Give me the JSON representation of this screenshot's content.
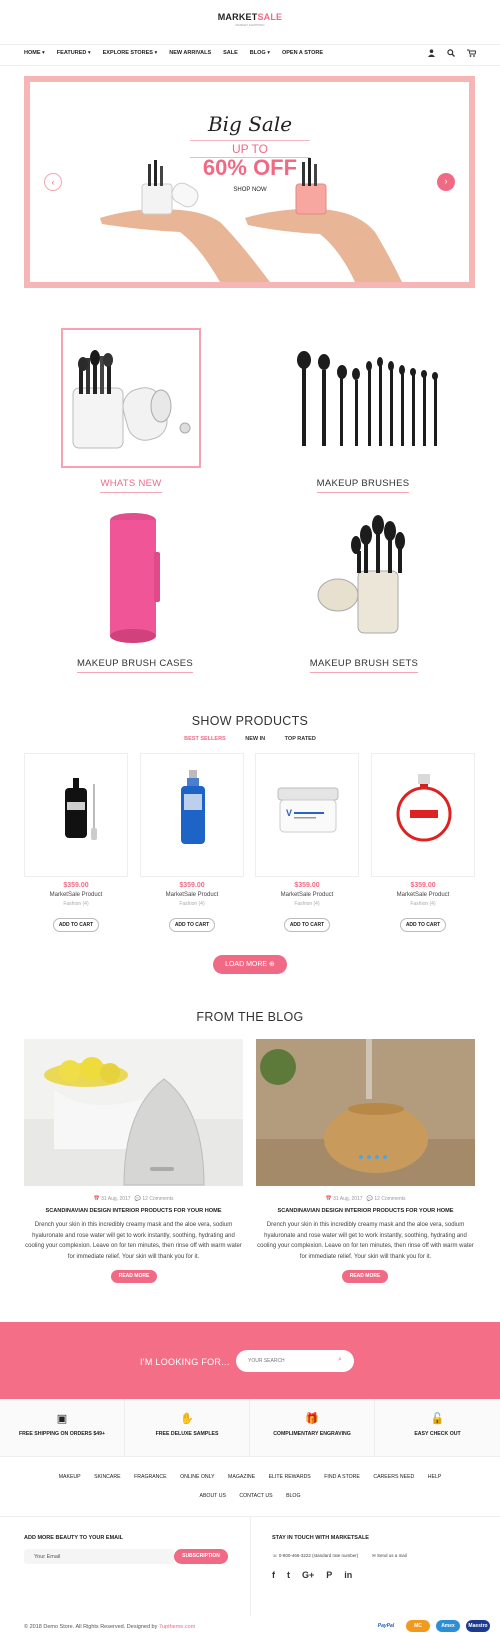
{
  "header": {
    "logo_main": "MARKET",
    "logo_accent": "SALE",
    "logo_tagline": "MARKET SHOPPING",
    "nav": [
      {
        "label": "HOME ▾"
      },
      {
        "label": "FEATURED ▾"
      },
      {
        "label": "EXPLORE STORES ▾"
      },
      {
        "label": "NEW ARRIVALS"
      },
      {
        "label": "SALE"
      },
      {
        "label": "BLOG ▾"
      },
      {
        "label": "OPEN A STORE"
      }
    ]
  },
  "hero": {
    "headline": "Big Sale",
    "upto": "UP TO",
    "discount": "60% OFF",
    "cta": "SHOP NOW",
    "frame_color": "#f7b6b6"
  },
  "categories": [
    {
      "label": "WHATS NEW"
    },
    {
      "label": "MAKEUP BRUSHES"
    },
    {
      "label": "MAKEUP BRUSH CASES"
    },
    {
      "label": "MAKEUP BRUSH SETS"
    }
  ],
  "products_section": {
    "title": "SHOW PRODUCTS",
    "tabs": [
      "BEST SELLERS",
      "NEW IN",
      "TOP RATED"
    ],
    "products": [
      {
        "price": "$359.00",
        "name": "MarketSale Product",
        "category": "Fashion (4)",
        "button": "ADD TO CART"
      },
      {
        "price": "$359.00",
        "name": "MarketSale Product",
        "category": "Fashion (4)",
        "button": "ADD TO CART"
      },
      {
        "price": "$359.00",
        "name": "MarketSale Product",
        "category": "Fashion (4)",
        "button": "ADD TO CART"
      },
      {
        "price": "$359.00",
        "name": "MarketSale Product",
        "category": "Fashion (4)",
        "button": "ADD TO CART"
      }
    ],
    "load_more": "LOAD MORE"
  },
  "blog": {
    "title": "FROM THE BLOG",
    "posts": [
      {
        "date": "31 Aug, 2017",
        "comments": "12 Comments",
        "title": "SCANDINAVIAN DESIGN INTERIOR PRODUCTS FOR YOUR HOME",
        "excerpt": "Drench your skin in this incredibly creamy mask and the aloe vera, sodium hyaluronate and rose water will get to work instantly, soothing, hydrating and cooling your complexion. Leave on for ten minutes, then rinse off with warm water for immediate relief. Your skin will thank you for it.",
        "button": "READ MORE"
      },
      {
        "date": "31 Aug, 2017",
        "comments": "12 Comments",
        "title": "SCANDINAVIAN DESIGN INTERIOR PRODUCTS FOR YOUR HOME",
        "excerpt": "Drench your skin in this incredibly creamy mask and the aloe vera, sodium hyaluronate and rose water will get to work instantly, soothing, hydrating and cooling your complexion. Leave on for ten minutes, then rinse off with warm water for immediate relief. Your skin will thank you for it.",
        "button": "READ MORE"
      }
    ]
  },
  "search_band": {
    "label": "I'M LOOKING FOR...",
    "placeholder": "YOUR SEARCH",
    "color": "#f56e87"
  },
  "features": [
    {
      "icon": "truck-icon",
      "label": "FREE SHIPPING ON ORDERS $49+"
    },
    {
      "icon": "hands-icon",
      "label": "FREE DELUXE SAMPLES"
    },
    {
      "icon": "gift-icon",
      "label": "COMPLIMENTARY ENGRAVING"
    },
    {
      "icon": "lock-icon",
      "label": "EASY CHECK OUT"
    }
  ],
  "footer_links": {
    "row1": [
      "MAKEUP",
      "SKINCARE",
      "FRAGRANCE",
      "ONLINE ONLY",
      "MAGAZINE",
      "ELITE REWARDS",
      "FIND A STORE",
      "CAREERS NEED",
      "HELP"
    ],
    "row2": [
      "ABOUT US",
      "CONTACT US",
      "BLOG"
    ]
  },
  "newsletter": {
    "title": "ADD MORE BEAUTY TO YOUR EMAIL",
    "placeholder": "Your Email",
    "button": "SUBSCRIPTION"
  },
  "contact": {
    "title": "STAY IN TOUCH WITH MARKETSALE",
    "phone": "0-800-466-3222 (standard rate number)",
    "email": "Send us a mail"
  },
  "copyright": {
    "text": "© 2018 Demo Store. All Rights Reserved. Designed by ",
    "link": "7uptheme.com"
  },
  "payment": [
    "PayPal",
    "MC",
    "Amex",
    "Maestro"
  ],
  "accent": "#f06a86"
}
